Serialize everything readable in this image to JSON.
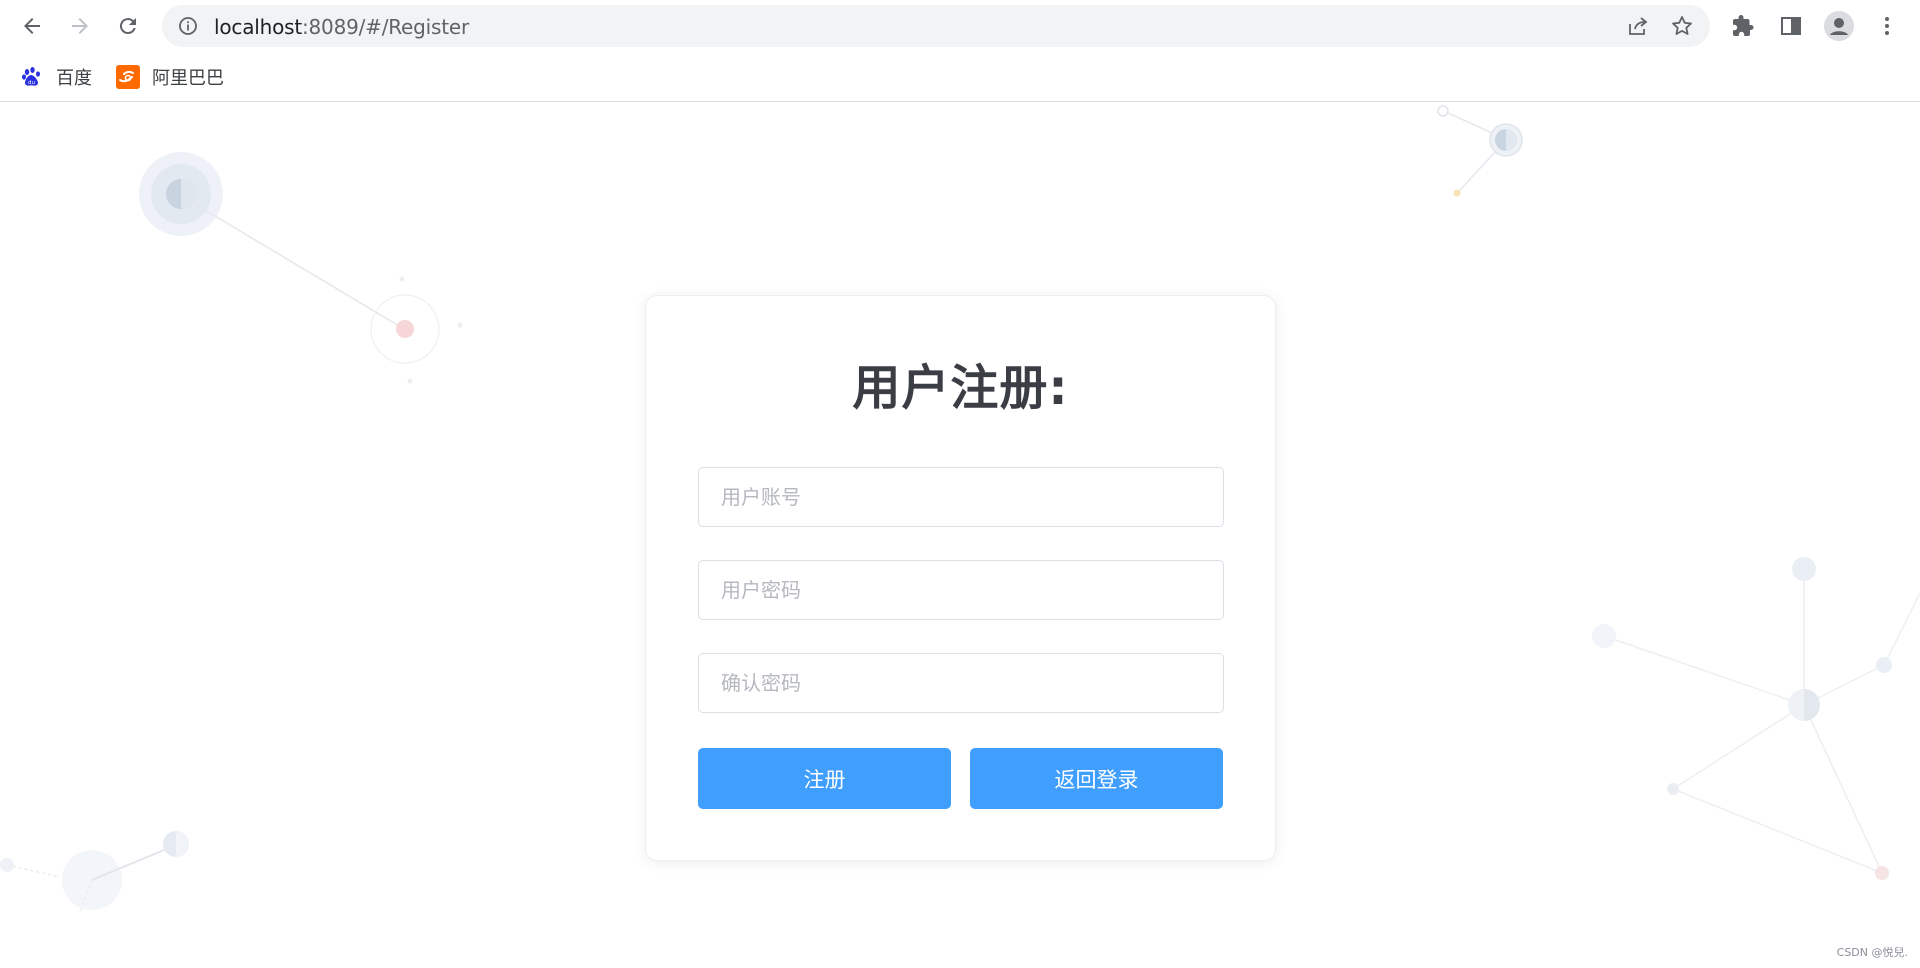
{
  "browser": {
    "url_host": "localhost",
    "url_rest": ":8089/#/Register",
    "bookmarks": [
      {
        "label": "百度",
        "icon": "baidu-icon"
      },
      {
        "label": "阿里巴巴",
        "icon": "alibaba-icon"
      }
    ]
  },
  "register": {
    "title": "用户注册:",
    "account_placeholder": "用户账号",
    "password_placeholder": "用户密码",
    "confirm_placeholder": "确认密码",
    "register_label": "注册",
    "back_label": "返回登录"
  },
  "watermark": "CSDN @悦兒.",
  "colors": {
    "primary": "#409eff",
    "title": "#3a3d44",
    "border": "#dcdfe6"
  }
}
